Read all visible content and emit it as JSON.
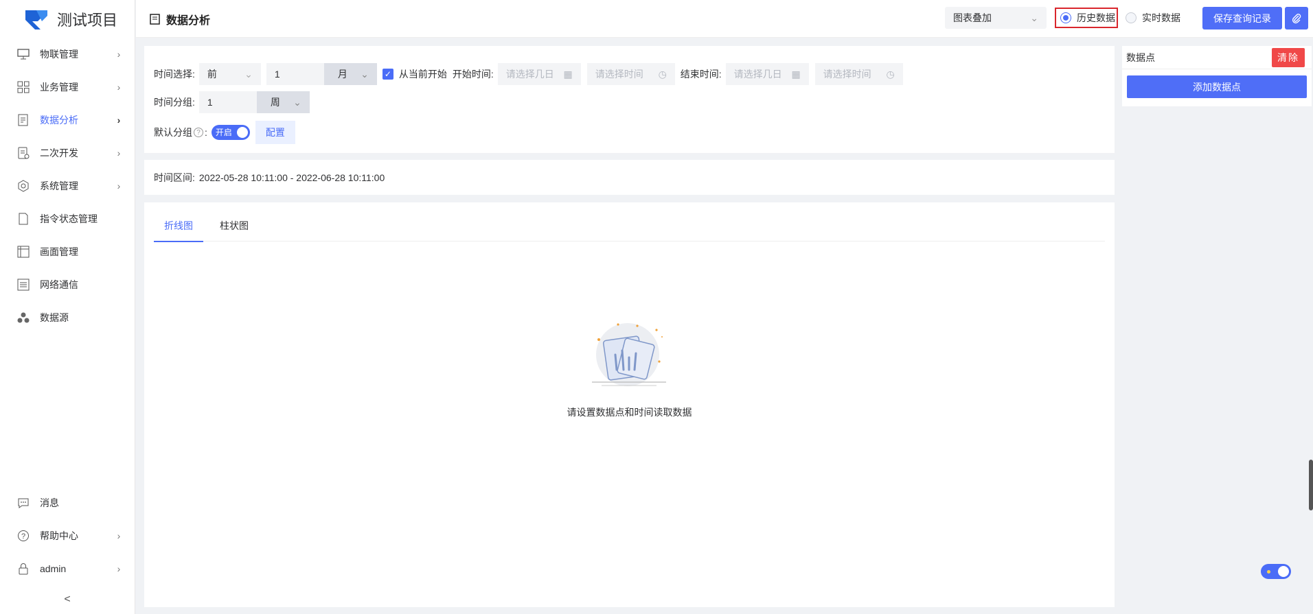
{
  "app": {
    "name": "测试项目"
  },
  "sidebar": {
    "items": [
      {
        "label": "物联管理",
        "icon": "monitor-icon",
        "has_children": true
      },
      {
        "label": "业务管理",
        "icon": "grid-icon",
        "has_children": true
      },
      {
        "label": "数据分析",
        "icon": "report-icon",
        "has_children": true,
        "active": true
      },
      {
        "label": "二次开发",
        "icon": "code-doc-icon",
        "has_children": true
      },
      {
        "label": "系统管理",
        "icon": "settings-icon",
        "has_children": true
      },
      {
        "label": "指令状态管理",
        "icon": "document-icon",
        "has_children": false
      },
      {
        "label": "画面管理",
        "icon": "canvas-icon",
        "has_children": false
      },
      {
        "label": "网络通信",
        "icon": "list-icon",
        "has_children": false
      },
      {
        "label": "数据源",
        "icon": "cluster-icon",
        "has_children": false
      }
    ],
    "bottom_items": [
      {
        "label": "消息",
        "icon": "chat-icon",
        "has_children": false
      },
      {
        "label": "帮助中心",
        "icon": "help-icon",
        "has_children": true
      },
      {
        "label": "admin",
        "icon": "lock-icon",
        "has_children": true
      }
    ],
    "collapse_glyph": "<"
  },
  "header": {
    "title": "数据分析",
    "chart_mode": "图表叠加",
    "radio_history": "历史数据",
    "radio_realtime": "实时数据",
    "save_button": "保存查询记录"
  },
  "filters": {
    "time_select_label": "时间选择:",
    "relative": "前",
    "amount": "1",
    "unit": "月",
    "from_now_label": "从当前开始",
    "start_label": "开始时间:",
    "date_placeholder": "请选择几日",
    "time_placeholder": "请选择时间",
    "end_label": "结束时间:",
    "group_label": "时间分组:",
    "group_amount": "1",
    "group_unit": "周",
    "default_group_label": "默认分组",
    "default_group_colon": ":",
    "switch_text": "开启",
    "config_button": "配置"
  },
  "range": {
    "label": "时间区间:",
    "value": "2022-05-28 10:11:00 - 2022-06-28 10:11:00"
  },
  "chart": {
    "tabs": [
      "折线图",
      "柱状图"
    ],
    "empty_text": "请设置数据点和时间读取数据"
  },
  "datapoints": {
    "title": "数据点",
    "clear_button": "清除",
    "add_button": "添加数据点"
  },
  "colors": {
    "accent": "#4a6cf7",
    "danger": "#f04848",
    "highlight": "#d9262c"
  }
}
